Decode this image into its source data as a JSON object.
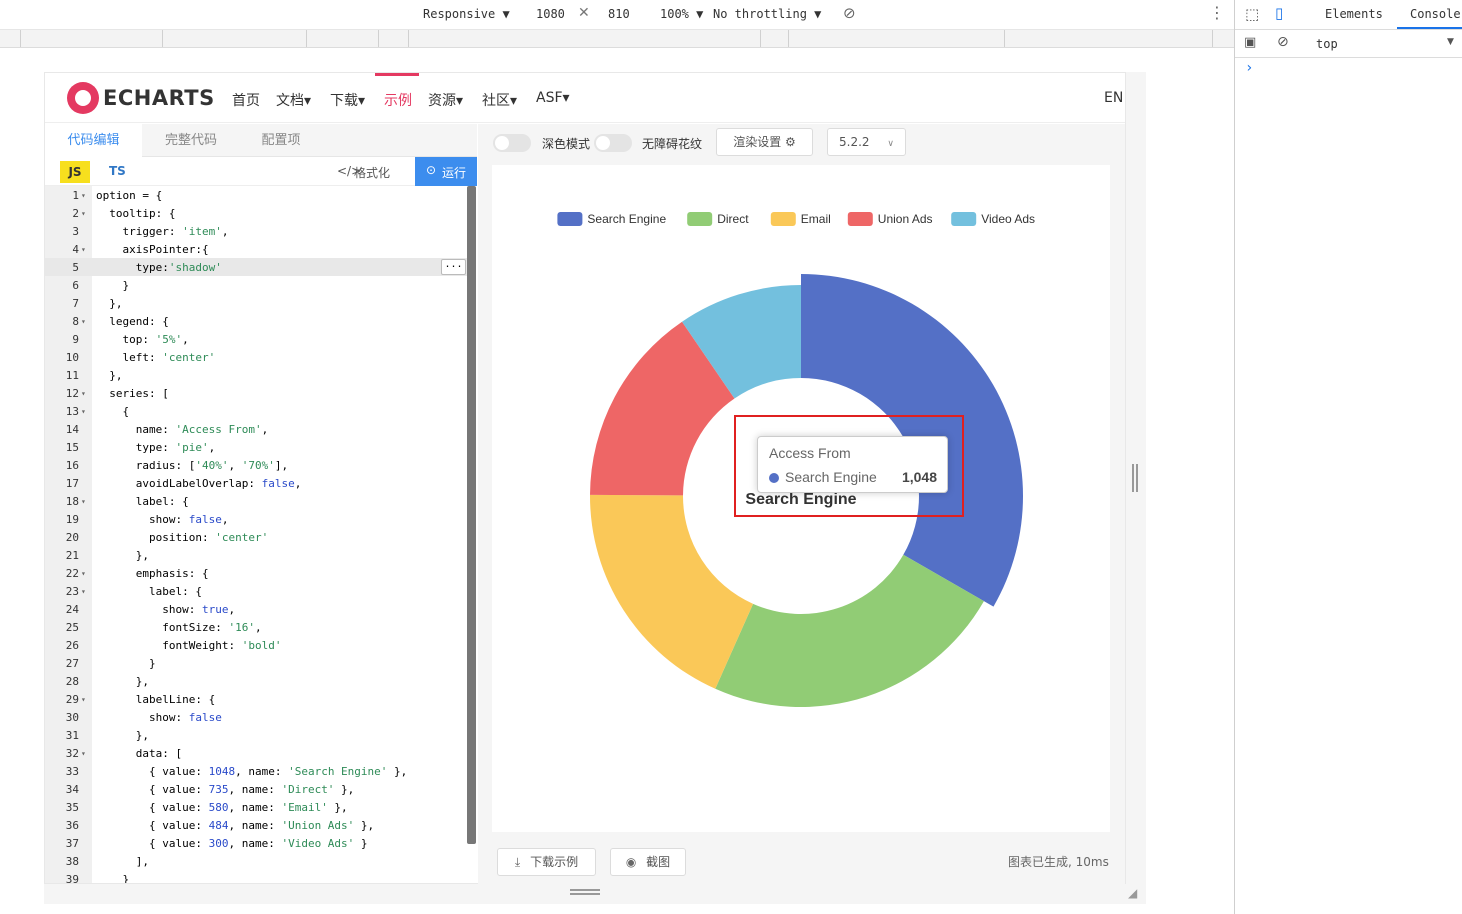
{
  "devtools": {
    "device": "Responsive ▼",
    "width": "1080",
    "height": "810",
    "zoom": "100% ▼",
    "throttle": "No throttling ▼",
    "tabs": [
      "Elements",
      "Console"
    ],
    "context": "top",
    "prompt": "›"
  },
  "nav": {
    "logo": "ECHARTS",
    "items": [
      "首页",
      "文档▾",
      "下载▾",
      "示例",
      "资源▾",
      "社区▾",
      "ASF▾"
    ],
    "lang": "EN"
  },
  "editor": {
    "tabs": [
      "代码编辑",
      "完整代码",
      "配置项"
    ],
    "js": "JS",
    "ts": "TS",
    "format": "格式化",
    "run": "运行",
    "ellipsis": "...",
    "lines": [
      "option = {",
      "  tooltip: {",
      "    trigger: 'item',",
      "    axisPointer:{",
      "      type:'shadow'",
      "    }",
      "  },",
      "  legend: {",
      "    top: '5%',",
      "    left: 'center'",
      "  },",
      "  series: [",
      "    {",
      "      name: 'Access From',",
      "      type: 'pie',",
      "      radius: ['40%', '70%'],",
      "      avoidLabelOverlap: false,",
      "      label: {",
      "        show: false,",
      "        position: 'center'",
      "      },",
      "      emphasis: {",
      "        label: {",
      "          show: true,",
      "          fontSize: '16',",
      "          fontWeight: 'bold'",
      "        }",
      "      },",
      "      labelLine: {",
      "        show: false",
      "      },",
      "      data: [",
      "        { value: 1048, name: 'Search Engine' },",
      "        { value: 735, name: 'Direct' },",
      "        { value: 580, name: 'Email' },",
      "        { value: 484, name: 'Union Ads' },",
      "        { value: 300, name: 'Video Ads' }",
      "      ],",
      "    }"
    ]
  },
  "toolbar": {
    "dark_mode": "深色模式",
    "accessible": "无障碍花纹",
    "render_settings": "渲染设置 ⚙",
    "version": "5.2.2",
    "download": "下载示例",
    "screenshot": "截图",
    "status": "图表已生成, 10ms"
  },
  "chart_data": {
    "type": "pie",
    "categories": [
      "Search Engine",
      "Direct",
      "Email",
      "Union Ads",
      "Video Ads"
    ],
    "values": [
      1048,
      735,
      580,
      484,
      300
    ],
    "colors": [
      "#5470c6",
      "#91cc75",
      "#fac858",
      "#ee6666",
      "#73c0de"
    ],
    "series_name": "Access From",
    "radius_inner": "40%",
    "radius_outer": "70%",
    "emphasized_index": 0,
    "center_label": "Search Engine",
    "legend_position": "top-center"
  },
  "tooltip": {
    "title": "Access From",
    "name": "Search Engine",
    "value": "1,048"
  }
}
